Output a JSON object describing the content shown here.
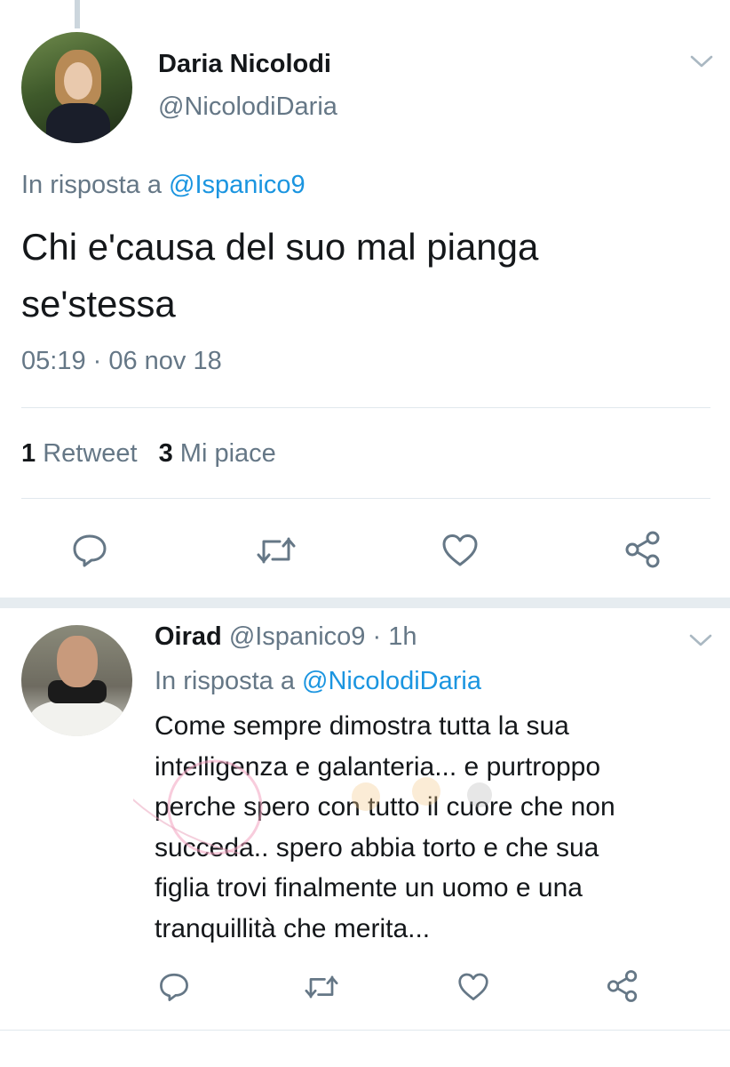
{
  "main_tweet": {
    "author_name": "Daria Nicolodi",
    "author_handle": "@NicolodiDaria",
    "reply_prefix": "In risposta a",
    "reply_mention": "@Ispanico9",
    "text_line1": "Chi e'causa del suo mal pianga",
    "text_line2": "se'stessa",
    "timestamp": "05:19 · 06 nov 18",
    "retweet_count": "1",
    "retweet_label": "Retweet",
    "like_count": "3",
    "like_label": "Mi piace"
  },
  "reply_tweet": {
    "author_name": "Oirad",
    "author_handle": "@Ispanico9",
    "separator": "·",
    "time_ago": "1h",
    "reply_prefix": "In risposta a",
    "reply_mention": "@NicolodiDaria",
    "lines": [
      "Come sempre dimostra tutta la sua",
      "intelligenza e galanteria... e purtroppo",
      "perche spero con tutto il cuore che non",
      "succeda.. spero abbia torto e che sua",
      "figlia trovi finalmente un uomo e una",
      "tranquillità che merita..."
    ]
  },
  "icons": {
    "menu": "chevron-down-icon",
    "reply": "reply-icon",
    "retweet": "retweet-icon",
    "like": "heart-icon",
    "share": "share-icon"
  },
  "colors": {
    "text": "#14171a",
    "secondary": "#657786",
    "link": "#1b95e0",
    "divider": "#e1e8ed",
    "section_gap": "#e6ecf0"
  }
}
